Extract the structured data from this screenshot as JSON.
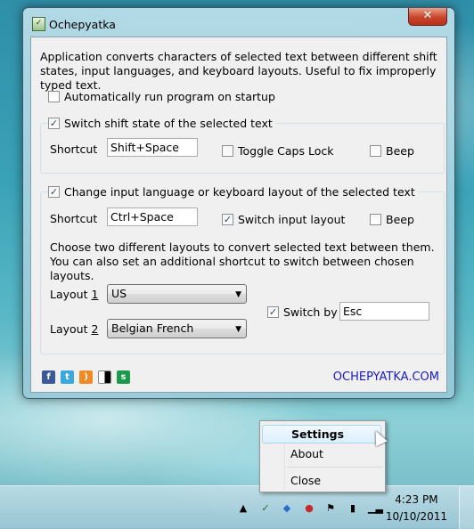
{
  "window": {
    "title": "Ochepyatka",
    "close_glyph": "✕"
  },
  "description": "Application converts characters of selected text between different shift states, input languages, and keyboard layouts. Useful to fix improperly typed text.",
  "autorun": {
    "label": "Automatically run program on startup",
    "checked": false
  },
  "shift_group": {
    "label": "Switch shift state of the selected text",
    "checked": true,
    "shortcut_label": "Shortcut",
    "shortcut_value": "Shift+Space",
    "toggle_caps_label": "Toggle Caps Lock",
    "toggle_caps_checked": false,
    "beep_label": "Beep",
    "beep_checked": false
  },
  "layout_group": {
    "label": "Change input language or keyboard layout of the selected text",
    "checked": true,
    "shortcut_label": "Shortcut",
    "shortcut_value": "Ctrl+Space",
    "switch_input_label": "Switch input layout",
    "switch_input_checked": true,
    "beep_label": "Beep",
    "beep_checked": false,
    "info": "Choose two different layouts to convert selected text between them. You can also set an additional shortcut to switch between chosen layouts.",
    "layout1_prefix": "Layout ",
    "layout1_num": "1",
    "layout1_value": "US",
    "layout2_prefix": "Layout ",
    "layout2_num": "2",
    "layout2_value": "Belgian French",
    "switch_by_label": "Switch by",
    "switch_by_checked": true,
    "switch_by_value": "Esc"
  },
  "social_icons": [
    "facebook-icon",
    "twitter-icon",
    "rss-icon",
    "delicious-icon",
    "stumbleupon-icon"
  ],
  "site_link": "OCHEPYATKA.COM",
  "context_menu": {
    "items": [
      "Settings",
      "About",
      "Close"
    ],
    "highlighted": "Settings"
  },
  "taskbar": {
    "time": "4:23 PM",
    "date": "10/10/2011"
  },
  "colors": {
    "link": "#1a1acc",
    "accent": "#c8452a"
  }
}
